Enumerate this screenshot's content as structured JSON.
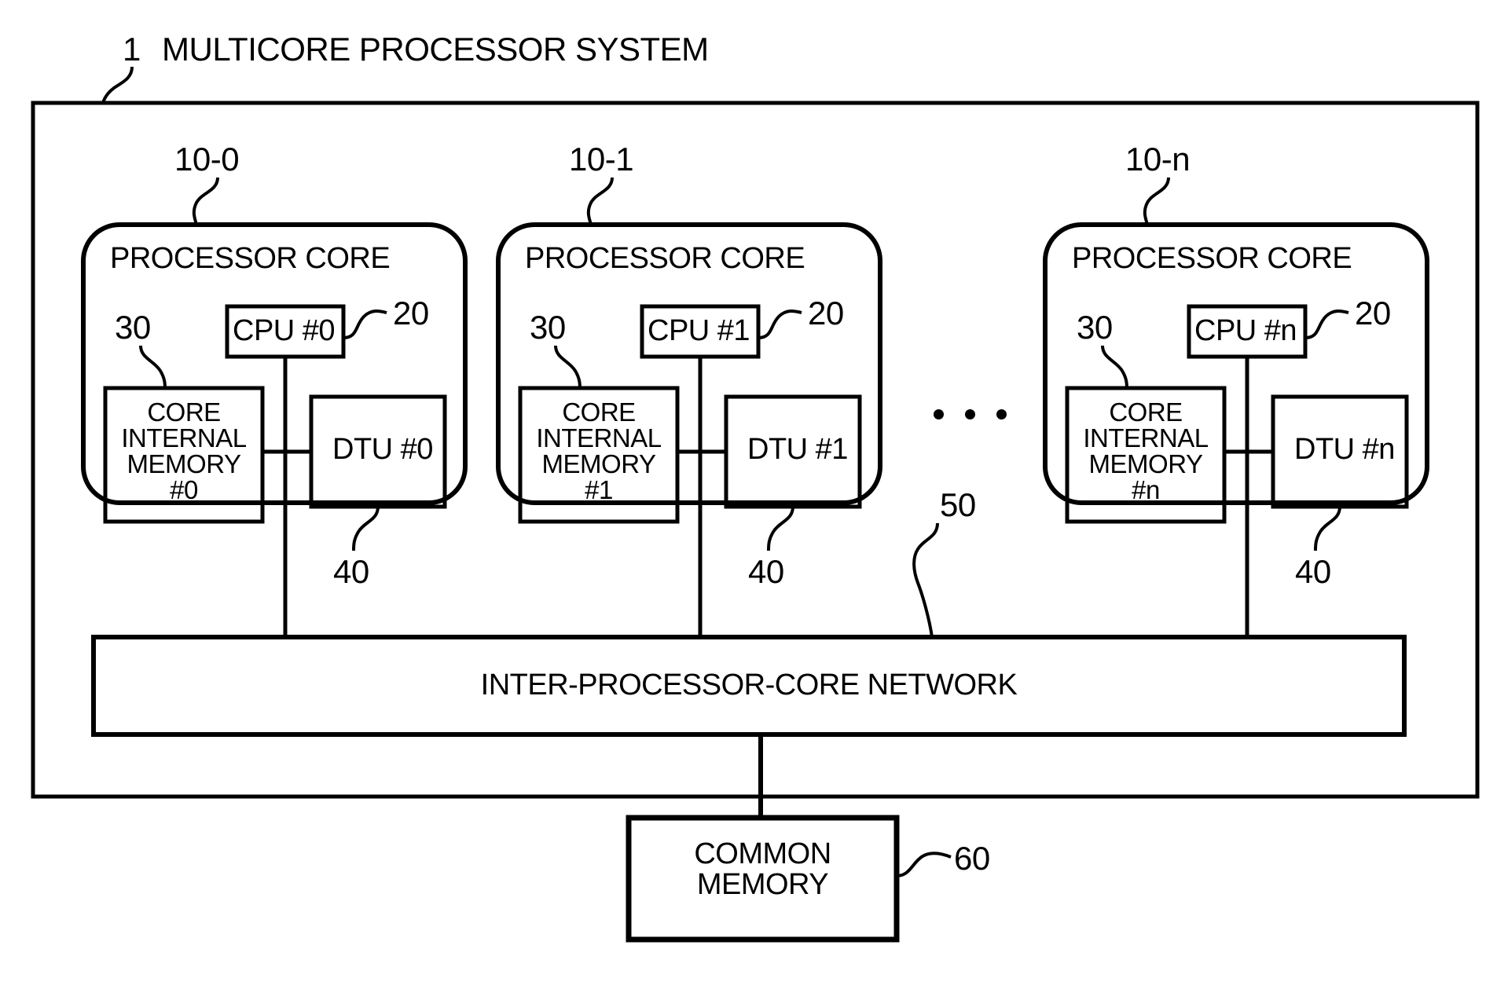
{
  "figure": {
    "system_ref": "1",
    "system_title": "MULTICORE PROCESSOR SYSTEM"
  },
  "cores": [
    {
      "ref": "10-0",
      "title": "PROCESSOR CORE",
      "memory_ref": "30",
      "cpu_ref": "20",
      "dtu_ref": "40",
      "cpu_label": "CPU #0",
      "memory_label": "CORE\nINTERNAL\nMEMORY\n#0",
      "dtu_label": "DTU #0"
    },
    {
      "ref": "10-1",
      "title": "PROCESSOR CORE",
      "memory_ref": "30",
      "cpu_ref": "20",
      "dtu_ref": "40",
      "cpu_label": "CPU #1",
      "memory_label": "CORE\nINTERNAL\nMEMORY\n#1",
      "dtu_label": "DTU #1"
    },
    {
      "ref": "10-n",
      "title": "PROCESSOR CORE",
      "memory_ref": "30",
      "cpu_ref": "20",
      "dtu_ref": "40",
      "cpu_label": "CPU #n",
      "memory_label": "CORE\nINTERNAL\nMEMORY\n#n",
      "dtu_label": "DTU #n"
    }
  ],
  "ellipsis": "...",
  "network": {
    "ref": "50",
    "label": "INTER-PROCESSOR-CORE NETWORK"
  },
  "common_memory": {
    "ref": "60",
    "label": "COMMON\nMEMORY"
  },
  "colors": {
    "stroke": "#000000",
    "background": "#ffffff"
  }
}
